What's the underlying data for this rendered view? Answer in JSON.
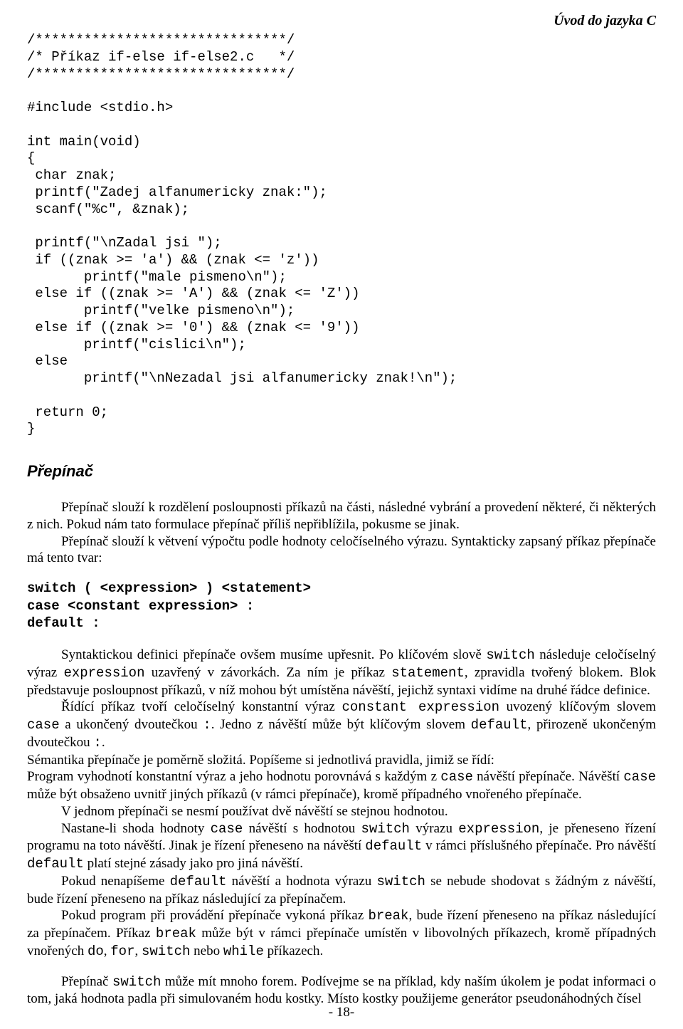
{
  "header": {
    "title": "Úvod do jazyka C"
  },
  "code": {
    "l01": "/*******************************/",
    "l02": "/* Příkaz if-else if-else2.c   */",
    "l03": "/*******************************/",
    "l04": "",
    "l05": "#include <stdio.h>",
    "l06": "",
    "l07": "int main(void)",
    "l08": "{",
    "l09": " char znak;",
    "l10": " printf(\"Zadej alfanumericky znak:\");",
    "l11": " scanf(\"%c\", &znak);",
    "l12": "",
    "l13": " printf(\"\\nZadal jsi \");",
    "l14": " if ((znak >= 'a') && (znak <= 'z'))",
    "l15": "       printf(\"male pismeno\\n\");",
    "l16": " else if ((znak >= 'A') && (znak <= 'Z'))",
    "l17": "       printf(\"velke pismeno\\n\");",
    "l18": " else if ((znak >= '0') && (znak <= '9'))",
    "l19": "       printf(\"cislici\\n\");",
    "l20": " else",
    "l21": "       printf(\"\\nNezadal jsi alfanumericky znak!\\n\");",
    "l22": "",
    "l23": " return 0;",
    "l24": "}"
  },
  "section": {
    "title": "Přepínač"
  },
  "para1": {
    "text": "Přepínač slouží k rozdělení posloupnosti příkazů na části, následné vybrání a provedení některé, či některých z nich. Pokud nám tato formulace přepínač příliš nepřiblížila, pokusme se jinak."
  },
  "para2": {
    "text": "Přepínač slouží k větvení výpočtu podle hodnoty celočíselného výrazu. Syntakticky zapsaný příkaz přepínače má tento tvar:"
  },
  "syntax": {
    "l1": "switch ( <expression> ) <statement>",
    "l2": "case <constant expression> :",
    "l3": "default :"
  },
  "para3": {
    "a": "Syntaktickou definici přepínače ovšem musíme upřesnit. Po klíčovém slově ",
    "switch": "switch",
    "b": " následuje celočíselný výraz ",
    "expression": "expression",
    "c": " uzavřený v závorkách. Za ním je příkaz ",
    "statement": "statement",
    "d": ", zpravidla tvořený blokem. Blok představuje posloupnost příkazů, v níž mohou být umístěna návěští, jejichž syntaxi vidíme na druhé řádce definice."
  },
  "para4": {
    "a": "Řídící příkaz tvoří celočíselný konstantní výraz ",
    "const": "constant expression",
    "b": " uvozený klíčovým slovem ",
    "case": "case",
    "c": " a ukončený dvoutečkou ",
    "colon1": ":",
    "d": ". Jedno z návěští může být klíčovým slovem ",
    "default": "default",
    "e": ", přirozeně ukončeným dvoutečkou ",
    "colon2": ":",
    "f": "."
  },
  "para5": {
    "text": "Sémantika přepínače je poměrně složitá. Popíšeme si jednotlivá pravidla, jimiž se řídí:"
  },
  "para6": {
    "a": "Program vyhodnotí konstantní výraz a jeho hodnotu porovnává s každým z ",
    "case1": "case",
    "b": " návěští přepínače. Návěští ",
    "case2": "case",
    "c": " může být obsaženo uvnitř jiných příkazů (v rámci přepínače), kromě případného vnořeného přepínače."
  },
  "para7": {
    "text": "V jednom přepínači se nesmí používat dvě návěští se stejnou hodnotou."
  },
  "para8": {
    "a": "Nastane-li shoda hodnoty ",
    "case": "case",
    "b": " návěští s hodnotou ",
    "switch": "switch",
    "c": " výrazu ",
    "expression": "expression",
    "d": ", je přeneseno řízení programu na toto návěští. Jinak je řízení přeneseno na návěští ",
    "default1": "default",
    "e": " v rámci příslušného přepínače. Pro návěští ",
    "default2": "default",
    "f": " platí stejné zásady jako pro jiná návěští."
  },
  "para9": {
    "a": "Pokud nenapíšeme ",
    "default": "default",
    "b": " návěští a hodnota výrazu ",
    "switch": "switch",
    "c": " se nebude shodovat s žádným z návěští, bude řízení přeneseno na příkaz následující za přepínačem."
  },
  "para10": {
    "a": "Pokud program při provádění přepínače vykoná příkaz ",
    "break1": "break",
    "b": ", bude řízení přeneseno na příkaz následující za přepínačem. Příkaz ",
    "break2": "break",
    "c": " může být v rámci přepínače umístěn v libovolných příkazech, kromě případných vnořených ",
    "do": "do",
    "comma1": ", ",
    "for": "for",
    "comma2": ", ",
    "switch": "switch",
    "nebo": " nebo ",
    "while": "while",
    "d": " příkazech."
  },
  "para11": {
    "a": "Přepínač ",
    "switch": "switch",
    "b": " může mít mnoho forem. Podívejme se na příklad, kdy naším úkolem je podat informaci o tom, jaká hodnota padla při simulovaném hodu kostky. Místo kostky použijeme generátor pseudonáhodných čísel"
  },
  "footer": {
    "page": "- 18-"
  }
}
